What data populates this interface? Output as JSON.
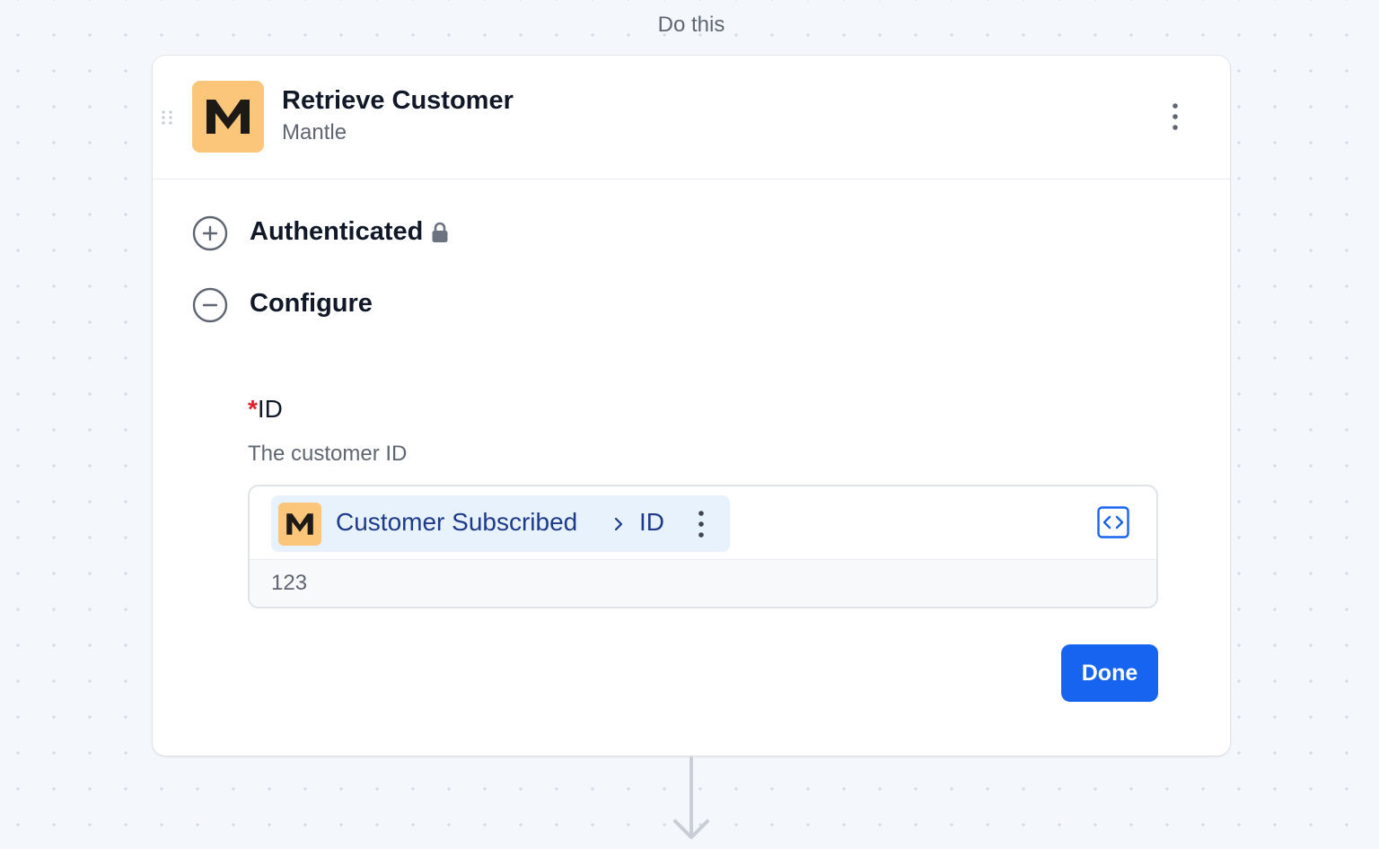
{
  "flow": {
    "step_label": "Do this"
  },
  "step": {
    "title": "Retrieve Customer",
    "app_name": "Mantle",
    "logo_letter": "M",
    "logo_color": "#fcc67a"
  },
  "sections": {
    "authenticated_label": "Authenticated",
    "configure_label": "Configure"
  },
  "field": {
    "required_marker": "*",
    "label": "ID",
    "help_text": "The customer ID",
    "token": {
      "logo_letter": "M",
      "source": "Customer Subscribed",
      "field": "ID"
    },
    "preview_value": "123"
  },
  "actions": {
    "done_label": "Done"
  },
  "colors": {
    "primary": "#1664f0",
    "required": "#e11d2b",
    "token_bg": "#e8f2fc",
    "token_text": "#1e3a8a"
  },
  "icons": {
    "drag": "drag-handle-icon",
    "menu": "more-vertical-icon",
    "expand": "plus-circle-icon",
    "collapse": "minus-circle-icon",
    "lock": "lock-icon",
    "chevron": "chevron-right-icon",
    "code": "code-icon",
    "arrow": "arrow-down-icon"
  }
}
